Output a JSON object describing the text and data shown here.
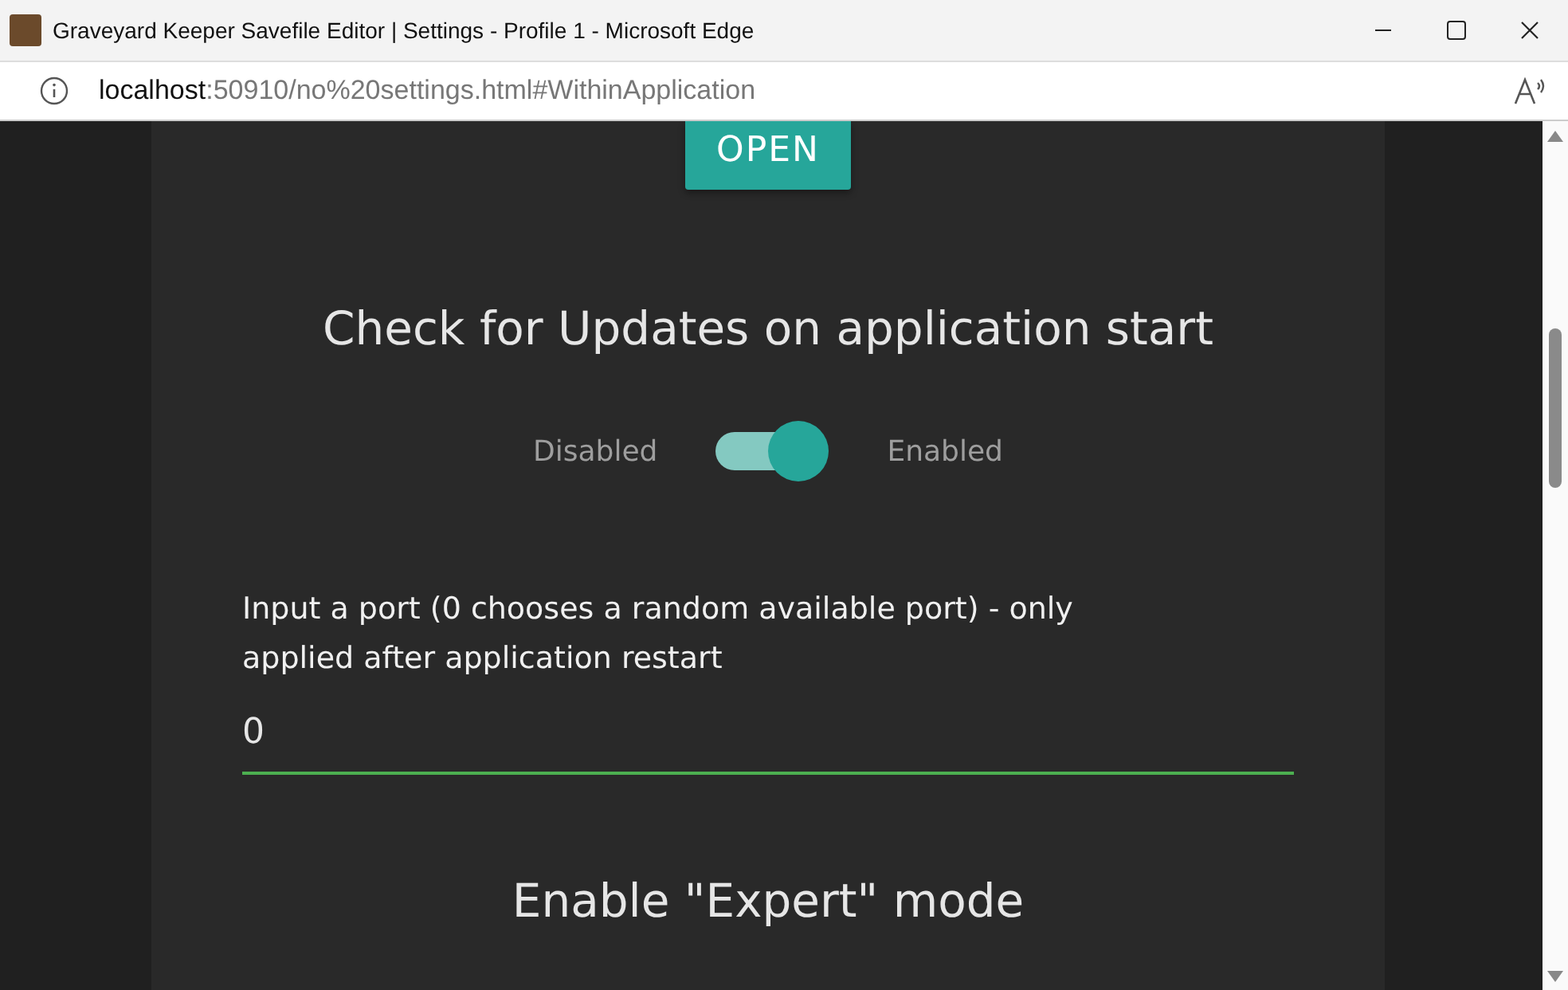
{
  "window": {
    "title": "Graveyard Keeper Savefile Editor | Settings - Profile 1 - Microsoft Edge"
  },
  "address_bar": {
    "host": "localhost",
    "path": ":50910/no%20settings.html#WithinApplication"
  },
  "open_button": "OPEN",
  "updates": {
    "heading": "Check for Updates on application start",
    "off_label": "Disabled",
    "on_label": "Enabled",
    "on": true
  },
  "port": {
    "label": "Input a port (0 chooses a random available port) - only applied after application restart",
    "value": "0"
  },
  "expert": {
    "heading": "Enable \"Expert\" mode"
  }
}
